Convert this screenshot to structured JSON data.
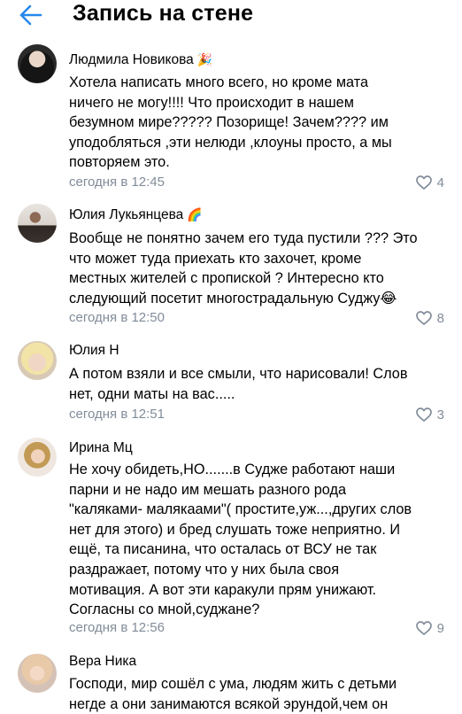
{
  "header": {
    "back_icon": "arrow-left-icon",
    "title": "Запись на стене"
  },
  "colors": {
    "accent": "#2688eb",
    "secondary_text": "#818c99",
    "emoji_yellow": "#f5c33b"
  },
  "comments": [
    {
      "author": "Людмила Новикова",
      "emoji": "🎉",
      "lines": [
        "Хотела написать много всего, но кроме мата",
        "ничего не могу!!!! Что происходит в нашем",
        "безумном мире????? Позорище! Зачем???? им",
        "уподобляться ,эти нелюди ,клоуны просто, а мы",
        "повторяем это."
      ],
      "time": "сегодня в 12:45",
      "likes": "4"
    },
    {
      "author": "Юлия Лукьянцева",
      "emoji": "🌈",
      "lines": [
        "Вообще не понятно зачем его туда пустили ??? Это",
        "что может туда приехать кто захочет, кроме",
        "местных жителей с пропиской ? Интересно кто",
        "следующий посетит многострадальную Суджу😂"
      ],
      "time": "сегодня в 12:50",
      "likes": "8"
    },
    {
      "author": "Юлия Н",
      "emoji": "",
      "lines": [
        "А потом взяли и все смыли, что нарисовали! Слов",
        "нет, одни маты на вас....."
      ],
      "time": "сегодня в 12:51",
      "likes": "3"
    },
    {
      "author": "Ирина Мц",
      "emoji": "",
      "lines": [
        "Не хочу обидеть,НО.......в Судже работают наши",
        "парни и не надо им мешать разного рода",
        "\"каляками- малякаами\"( простите,уж...,других слов",
        "нет для этого) и бред слушать тоже неприятно. И",
        "ещё, та писанина, что осталась от ВСУ не так",
        "раздражает, потому что у них была своя",
        "мотивация. А вот эти каракули прям унижают.",
        "Согласны со мной,суджане?"
      ],
      "time": "сегодня в 12:56",
      "likes": "9"
    },
    {
      "author": "Вера Ника",
      "emoji": "",
      "lines": [
        "Господи, мир сошёл с ума, людям жить с детьми",
        "негде а они занимаются всякой эрундой,чем он"
      ],
      "time": "",
      "likes": ""
    }
  ]
}
